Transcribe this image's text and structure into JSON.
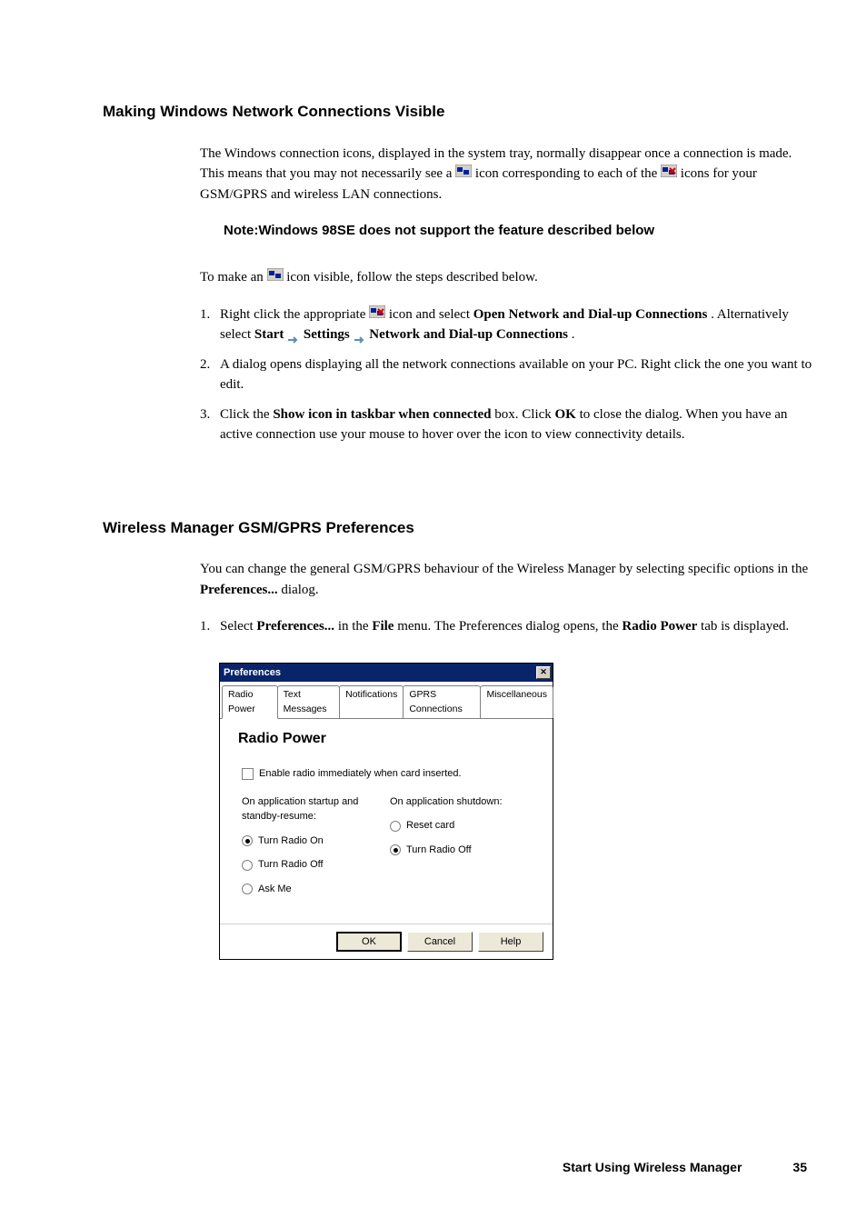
{
  "section1": {
    "heading": "Making Windows Network Connections Visible",
    "para1_part1": "The Windows connection icons, displayed in the system tray, normally disappear once a connection is made. This means that you may not necessarily see a ",
    "para1_part2": " icon corresponding to each of the ",
    "para1_part3": " icons for your GSM/GPRS and wireless LAN connections.",
    "note": "Note:Windows 98SE does not support the feature described below",
    "para2_part1": "To make an ",
    "para2_part2": " icon visible, follow the steps described below.",
    "list": [
      {
        "num": "1.",
        "text_a": "Right click the appropriate ",
        "text_b": " icon and select ",
        "bold_b": "Open Network and Dial-up Connections",
        "text_c": ". Alternatively select ",
        "bold_c": "Start",
        "text_d": " ",
        "bold_d": "Settings",
        "text_e": " ",
        "bold_e": "Network and Dial-up Connections",
        "text_f": "."
      },
      {
        "num": "2.",
        "text_a": "A dialog opens displaying all the network connections available on your PC. Right click the one you want to edit."
      },
      {
        "num": "3.",
        "text_a": "Click the ",
        "bold_a": "Show icon in taskbar when connected",
        "text_b": " box. Click ",
        "bold_b": "OK",
        "text_c": " to close the dialog. When you have an active connection use your mouse to hover over the icon to view connectivity details."
      }
    ]
  },
  "section2": {
    "heading": "Wireless Manager GSM/GPRS Preferences",
    "para1_a": "You can change the general GSM/GPRS behaviour of the Wireless Manager by selecting specific options in the ",
    "para1_bold": "Preferences...",
    "para1_b": " dialog.",
    "list_num": "1.",
    "list_text_a": "Select ",
    "list_bold_a": "Preferences...",
    "list_text_b": " in the ",
    "list_bold_b": "File",
    "list_text_c": " menu. The Preferences dialog opens, the ",
    "list_bold_c": "Radio Power",
    "list_text_d": " tab is displayed."
  },
  "dialog": {
    "title": "Preferences",
    "close": "✕",
    "tabs": [
      "Radio Power",
      "Text Messages",
      "Notifications",
      "GPRS Connections",
      "Miscellaneous"
    ],
    "heading": "Radio Power",
    "checkbox_label": "Enable radio immediately when card inserted.",
    "col1_heading": "On application startup and standby-resume:",
    "col1_options": [
      "Turn Radio On",
      "Turn Radio Off",
      "Ask Me"
    ],
    "col2_heading": "On application shutdown:",
    "col2_options": [
      "Reset card",
      "Turn Radio Off"
    ],
    "buttons": [
      "OK",
      "Cancel",
      "Help"
    ]
  },
  "footer": {
    "text": "Start Using Wireless Manager",
    "page": "35"
  }
}
